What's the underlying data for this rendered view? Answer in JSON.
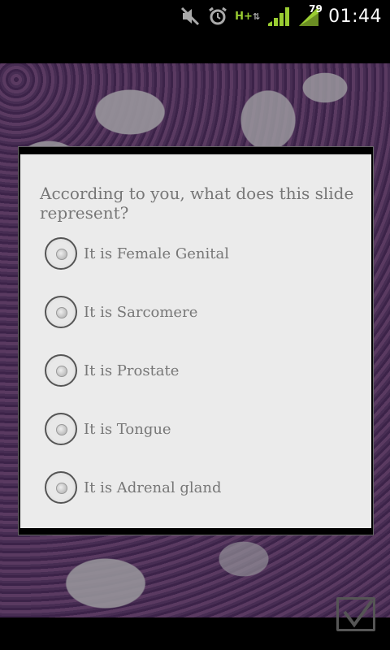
{
  "status_bar": {
    "battery_level": "79",
    "network_type": "H+",
    "time": "01:44",
    "icons": [
      "mute-icon",
      "alarm-icon",
      "network-type-icon",
      "signal-icon",
      "battery-icon"
    ]
  },
  "dialog": {
    "question": "According to you, what does this slide represent?",
    "options": [
      {
        "label": "It is Female Genital"
      },
      {
        "label": "It is Sarcomere"
      },
      {
        "label": "It is Prostate"
      },
      {
        "label": "It is Tongue"
      },
      {
        "label": "It is Adrenal gland"
      }
    ]
  },
  "confirm": {
    "icon": "checkbox-check-icon"
  },
  "colors": {
    "dialog_bg": "#ebebeb",
    "text": "#777777",
    "network_accent": "#9acd32"
  }
}
